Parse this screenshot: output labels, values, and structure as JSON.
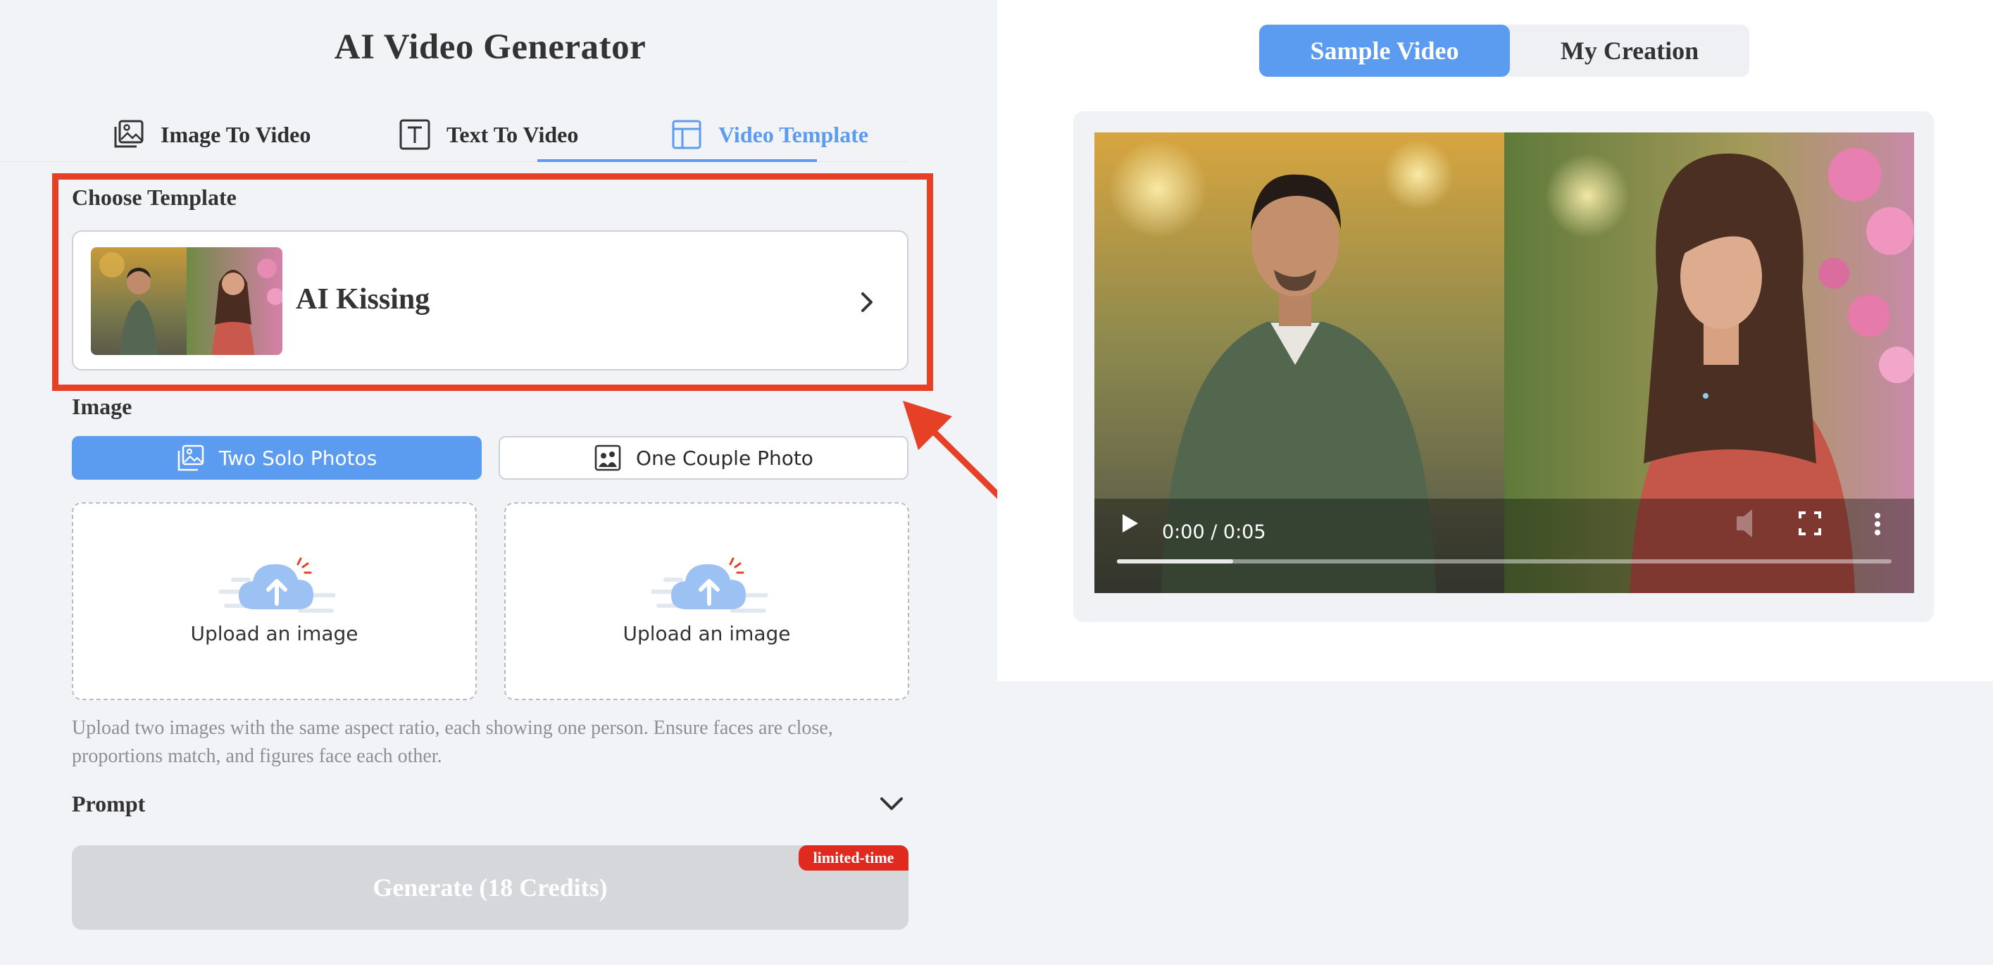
{
  "app": {
    "title": "AI Video Generator"
  },
  "tabs": [
    {
      "label": "Image To Video",
      "icon": "image-stack-icon",
      "active": false
    },
    {
      "label": "Text To Video",
      "icon": "text-box-icon",
      "active": false
    },
    {
      "label": "Video Template",
      "icon": "template-layout-icon",
      "active": true
    }
  ],
  "template": {
    "section_label": "Choose Template",
    "selected_name": "AI Kissing",
    "icon": "chevron-right-icon"
  },
  "image": {
    "section_label": "Image",
    "options": [
      {
        "label": "Two Solo Photos",
        "icon": "photos-icon",
        "selected": true
      },
      {
        "label": "One Couple Photo",
        "icon": "couple-photo-icon",
        "selected": false
      }
    ],
    "upload_slots": [
      {
        "label": "Upload an image"
      },
      {
        "label": "Upload an image"
      }
    ],
    "hint_line1": "Upload two images with the same aspect ratio, each showing one person. Ensure faces are close,",
    "hint_line2": "proportions match, and figures face each other."
  },
  "prompt": {
    "label": "Prompt",
    "icon": "chevron-down-icon"
  },
  "generate": {
    "label": "Generate (18 Credits)",
    "badge": "limited-time",
    "enabled": false
  },
  "preview": {
    "tabs": [
      {
        "label": "Sample Video",
        "active": true
      },
      {
        "label": "My Creation",
        "active": false
      }
    ],
    "player": {
      "time": "0:00 / 0:05",
      "progress": 0.15
    }
  },
  "colors": {
    "accent": "#5b9bf0",
    "highlight": "#e64027",
    "badge": "#e02a1f"
  }
}
